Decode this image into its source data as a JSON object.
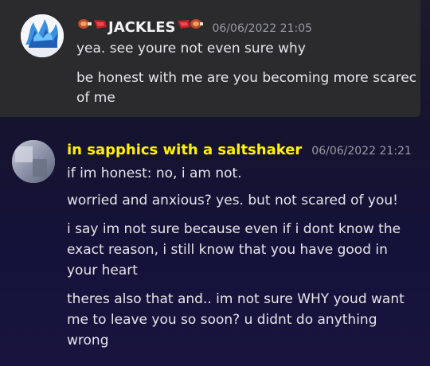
{
  "messages": [
    {
      "username": "JACKLES",
      "timestamp": "06/06/2022 21:05",
      "lines": [
        "yea. see youre not even sure why",
        "be honest with me are you becoming more scarec",
        "of me"
      ]
    },
    {
      "username": "in sapphics with a saltshaker",
      "timestamp": "06/06/2022 21:21",
      "lines": [
        "if im honest: no, i am not.",
        "worried and anxious? yes. but not scared of you!",
        "i say im not sure because even if i dont know the",
        "exact reason, i still know that you have good in",
        "your heart",
        "theres also that and.. im not sure WHY youd want",
        "me to leave you so soon? u didnt do anything",
        "wrong"
      ]
    }
  ],
  "icons": {
    "avatar-1": "blue-flames-avatar",
    "avatar-2": "blurred-gray-avatar",
    "deco": "meat-icon"
  },
  "colors": {
    "username_2": "#fff200",
    "timestamp": "#9a9aa5",
    "highlight_bg": "#2b2b2d"
  }
}
